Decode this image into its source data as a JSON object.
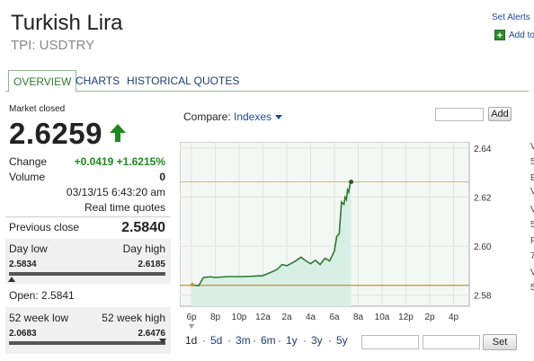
{
  "header": {
    "title": "Turkish Lira",
    "subtitle": "TPI: USDTRY",
    "set_alerts": "Set Alerts",
    "add_to": "Add to"
  },
  "tabs": [
    {
      "label": "OVERVIEW",
      "active": true
    },
    {
      "label": "CHARTS",
      "active": false
    },
    {
      "label": "HISTORICAL QUOTES",
      "active": false
    }
  ],
  "quote": {
    "status": "Market closed",
    "price": "2.6259",
    "direction": "up",
    "change_label": "Change",
    "change_value": "+0.0419 +1.6215%",
    "volume_label": "Volume",
    "volume_value": "0",
    "timestamp": "03/13/15 6:43:20 am",
    "quote_type": "Real time quotes",
    "prev_close_label": "Previous close",
    "prev_close_value": "2.5840",
    "day_low_label": "Day low",
    "day_high_label": "Day high",
    "day_low_value": "2.5834",
    "day_high_value": "2.6185",
    "open_text": "Open: 2.5841",
    "week52_low_label": "52 week low",
    "week52_high_label": "52 week high",
    "week52_low_value": "2.0683",
    "week52_high_value": "2.6476",
    "week52_position": 0.98
  },
  "compare": {
    "label": "Compare:",
    "selected": "Indexes",
    "add_label": "Add"
  },
  "chart_data": {
    "type": "line",
    "x_ticks": [
      "6p",
      "8p",
      "10p",
      "12a",
      "2a",
      "4a",
      "6a",
      "8a",
      "10a",
      "12p",
      "2p",
      "4p"
    ],
    "y_ticks": [
      "2.64",
      "2.62",
      "2.60",
      "2.58"
    ],
    "ylim": [
      2.5755,
      2.6425
    ],
    "prev_close_line": 2.584,
    "high_line": 2.6262,
    "x": [
      0,
      0.3,
      0.5,
      0.8,
      1.0,
      1.5,
      2,
      2.5,
      3,
      3.3,
      3.6,
      3.8,
      4,
      4.3,
      4.6,
      4.8,
      5.0,
      5.2,
      5.4,
      5.6,
      5.8,
      6.0,
      6.1,
      6.2,
      6.3,
      6.4,
      6.45,
      6.5,
      6.55,
      6.6,
      6.65,
      6.7
    ],
    "y": [
      2.5843,
      2.5838,
      2.5872,
      2.5875,
      2.5872,
      2.5876,
      2.5876,
      2.5877,
      2.588,
      2.5892,
      2.5905,
      2.5925,
      2.592,
      2.5935,
      2.5955,
      2.594,
      2.5928,
      2.5942,
      2.5925,
      2.595,
      2.594,
      2.598,
      2.604,
      2.605,
      2.618,
      2.617,
      2.62,
      2.619,
      2.623,
      2.622,
      2.625,
      2.6262
    ],
    "grid": true,
    "accent_color": "#2f7a2f",
    "fill_color": "#d8efe6"
  },
  "ranges": [
    "1d",
    "5d",
    "3m",
    "6m",
    "1y",
    "3y",
    "5y"
  ],
  "active_range": "1d",
  "set_label": "Set",
  "side_letters": [
    "V",
    "5",
    "E",
    "V",
    "V",
    "5",
    "F",
    "7",
    "V",
    "5"
  ]
}
